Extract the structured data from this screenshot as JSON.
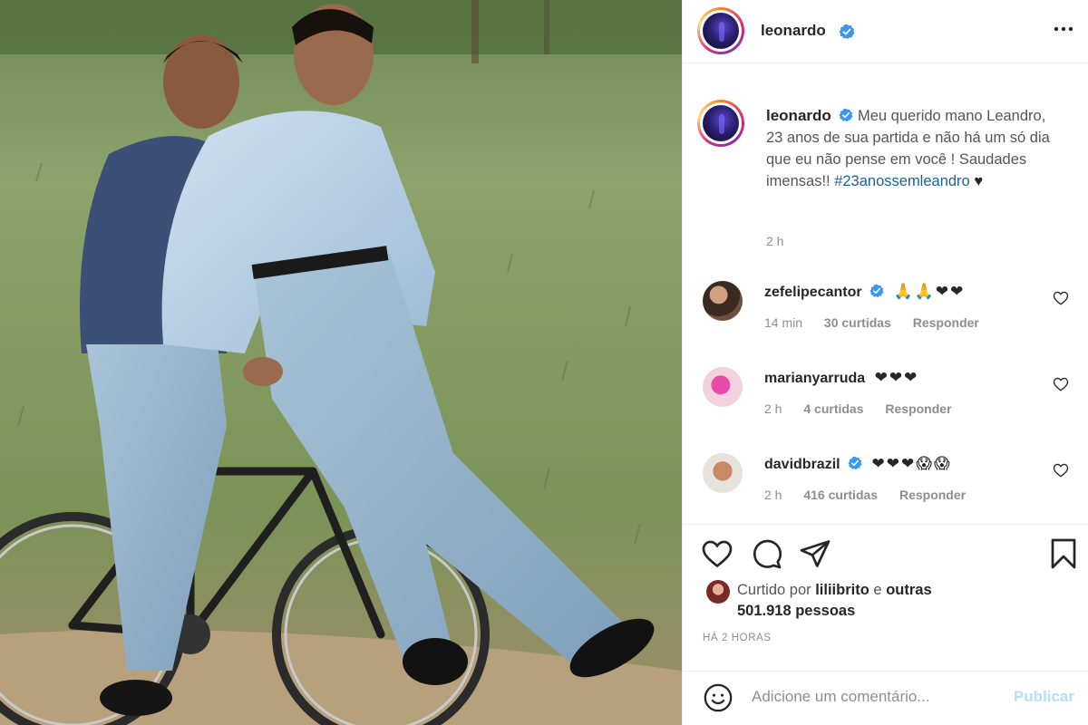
{
  "post": {
    "author": "leonardo",
    "caption_text": "Meu querido mano Leandro, 23 anos de sua partida e não há um só dia que eu não pense em você ! Saudades imensas!! ",
    "hashtag": "#23anossemleandro",
    "caption_emoji": "♥",
    "caption_time": "2 h",
    "photo_icon": "photo-two-men-on-bicycle"
  },
  "comments": [
    {
      "user": "zefelipecantor",
      "verified": true,
      "text": "🙏🙏❤❤",
      "time": "14 min",
      "likes": "30 curtidas",
      "reply": "Responder"
    },
    {
      "user": "marianyarruda",
      "verified": false,
      "text": "❤❤❤",
      "time": "2 h",
      "likes": "4 curtidas",
      "reply": "Responder"
    },
    {
      "user": "davidbrazil",
      "verified": true,
      "text": "❤❤❤😱😱",
      "time": "2 h",
      "likes": "416 curtidas",
      "reply": "Responder"
    }
  ],
  "likes": {
    "prefix": "Curtido por",
    "user": "liliibrito",
    "connector": "e",
    "others": "outras 501.918 pessoas"
  },
  "posted": "HÁ 2 HORAS",
  "add_comment": {
    "placeholder": "Adicione um comentário...",
    "publish": "Publicar"
  },
  "icons": {
    "more": "more-options-icon",
    "like": "heart-icon",
    "comment": "comment-icon",
    "share": "share-icon",
    "save": "bookmark-icon",
    "emoji": "emoji-icon",
    "verified": "verified-badge-icon"
  },
  "colors": {
    "verified": "#3897f0",
    "hashtag": "#1e5e9c",
    "publish_disabled": "#b2dffc",
    "muted": "#8e8e8e"
  }
}
